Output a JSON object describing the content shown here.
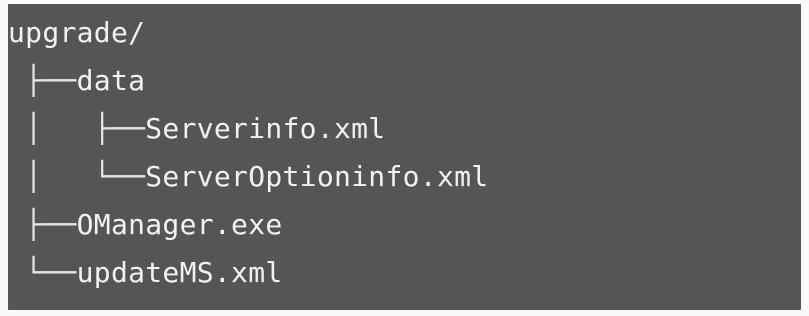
{
  "tree": {
    "lines": [
      {
        "prefix": "",
        "name": "upgrade/"
      },
      {
        "prefix": " ├──",
        "name": "data"
      },
      {
        "prefix": " │   ├──",
        "name": "Serverinfo.xml"
      },
      {
        "prefix": " │   └──",
        "name": "ServerOptioninfo.xml"
      },
      {
        "prefix": " ├──",
        "name": "OManager.exe"
      },
      {
        "prefix": " └──",
        "name": "updateMS.xml"
      }
    ]
  }
}
